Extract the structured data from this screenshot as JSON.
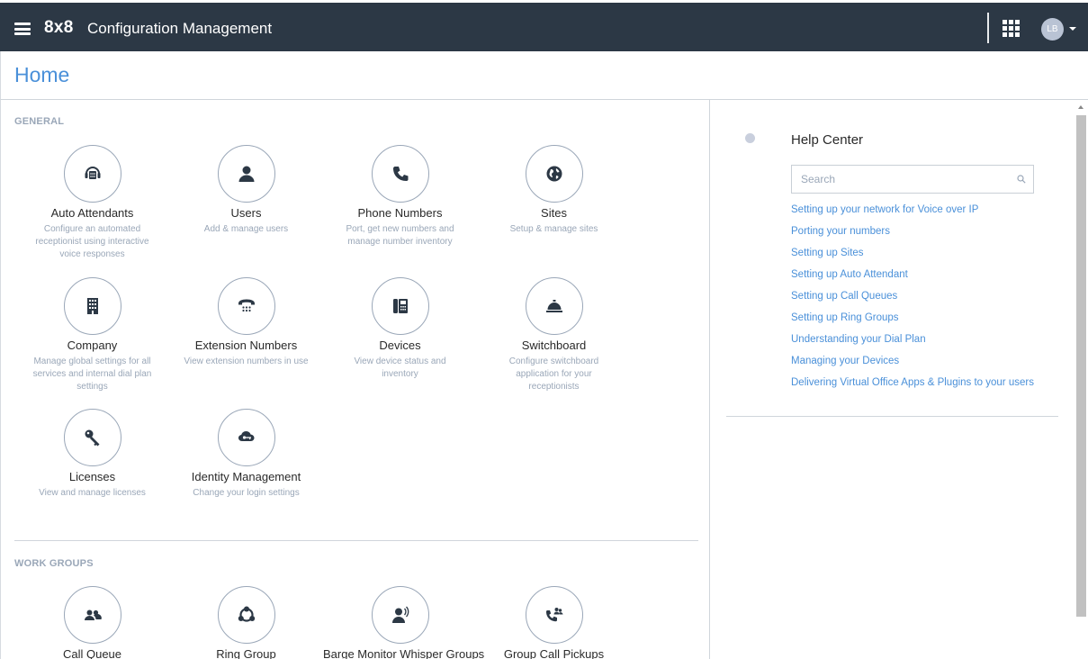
{
  "header": {
    "logo": "8x8",
    "title": "Configuration Management",
    "user_initials": "LB"
  },
  "page": {
    "title": "Home"
  },
  "general": {
    "label": "GENERAL",
    "tiles": [
      {
        "name": "Auto Attendants",
        "desc": "Configure an automated receptionist using interactive voice responses",
        "icon": "auto-attendant-icon"
      },
      {
        "name": "Users",
        "desc": "Add & manage users",
        "icon": "user-icon"
      },
      {
        "name": "Phone Numbers",
        "desc": "Port, get new numbers and manage number inventory",
        "icon": "phone-icon"
      },
      {
        "name": "Sites",
        "desc": "Setup & manage sites",
        "icon": "globe-icon"
      },
      {
        "name": "Company",
        "desc": "Manage global settings for all services and internal dial plan settings",
        "icon": "building-icon"
      },
      {
        "name": "Extension Numbers",
        "desc": "View extension numbers in use",
        "icon": "desk-phone-icon"
      },
      {
        "name": "Devices",
        "desc": "View device status and inventory",
        "icon": "ip-phone-icon"
      },
      {
        "name": "Switchboard",
        "desc": "Configure switchboard application for your receptionists",
        "icon": "service-bell-icon"
      },
      {
        "name": "Licenses",
        "desc": "View and manage licenses",
        "icon": "key-icon"
      },
      {
        "name": "Identity Management",
        "desc": "Change your login settings",
        "icon": "identity-icon"
      }
    ]
  },
  "work_groups": {
    "label": "WORK GROUPS",
    "tiles": [
      {
        "name": "Call Queue",
        "icon": "call-queue-icon"
      },
      {
        "name": "Ring Group",
        "icon": "ring-group-icon"
      },
      {
        "name": "Barge Monitor Whisper Groups",
        "icon": "barge-monitor-icon"
      },
      {
        "name": "Group Call Pickups",
        "icon": "group-call-pickup-icon"
      }
    ]
  },
  "help": {
    "title": "Help Center",
    "search_placeholder": "Search",
    "links": [
      "Setting up your network for Voice over IP",
      "Porting your numbers",
      "Setting up Sites",
      "Setting up Auto Attendant",
      "Setting up Call Queues",
      "Setting up Ring Groups",
      "Understanding your Dial Plan",
      "Managing your Devices",
      "Delivering Virtual Office Apps & Plugins to your users"
    ]
  },
  "colors": {
    "topbar": "#2c3845",
    "accent": "#4a90d9",
    "muted": "#9aa7b8",
    "icon": "#2c3845"
  }
}
